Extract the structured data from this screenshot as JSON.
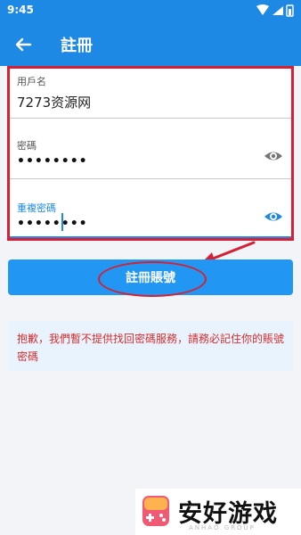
{
  "status_bar": {
    "time": "9:45"
  },
  "app_bar": {
    "title": "註冊"
  },
  "form": {
    "username": {
      "label": "用戶名",
      "value": "7273资源网"
    },
    "password": {
      "label": "密碼",
      "value": "••••••••"
    },
    "confirm_password": {
      "label": "重複密碼",
      "value": "••••••••"
    }
  },
  "register_button": {
    "label": "註冊賬號"
  },
  "notice": {
    "text": "抱歉，我們暫不提供找回密碼服務，請務必記住你的賬號密碼"
  },
  "watermark": {
    "text": "安好游戏",
    "sub": "ANHAO GROUP"
  },
  "colors": {
    "primary": "#1e88e5",
    "annotation_red": "#d62033",
    "notice_text": "#d32f2f",
    "notice_bg": "#e8f3fd"
  }
}
